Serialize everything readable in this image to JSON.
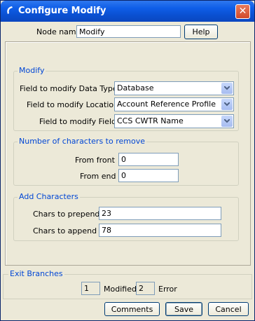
{
  "window": {
    "title": "Configure Modify"
  },
  "node": {
    "label": "Node name",
    "value": "Modify",
    "help_label": "Help"
  },
  "modify": {
    "title": "Modify",
    "data_type_label": "Field to modify Data Type",
    "data_type_value": "Database",
    "location_label": "Field to modify Location",
    "location_value": "Account Reference Profile",
    "field_label": "Field to modify Field",
    "field_value": "CCS CWTR Name"
  },
  "remove": {
    "title": "Number of characters to remove",
    "front_label": "From front",
    "front_value": "0",
    "end_label": "From end",
    "end_value": "0"
  },
  "add": {
    "title": "Add Characters",
    "prepend_label": "Chars to prepend",
    "prepend_value": "23",
    "append_label": "Chars to append",
    "append_value": "78"
  },
  "exit": {
    "title": "Exit Branches",
    "modified_num": "1",
    "modified_label": "Modified",
    "error_num": "2",
    "error_label": "Error"
  },
  "buttons": {
    "comments": "Comments",
    "save": "Save",
    "cancel": "Cancel"
  },
  "icons": {
    "title": "app-icon",
    "close": "close-icon",
    "dropdown": "chevron-down-icon"
  }
}
